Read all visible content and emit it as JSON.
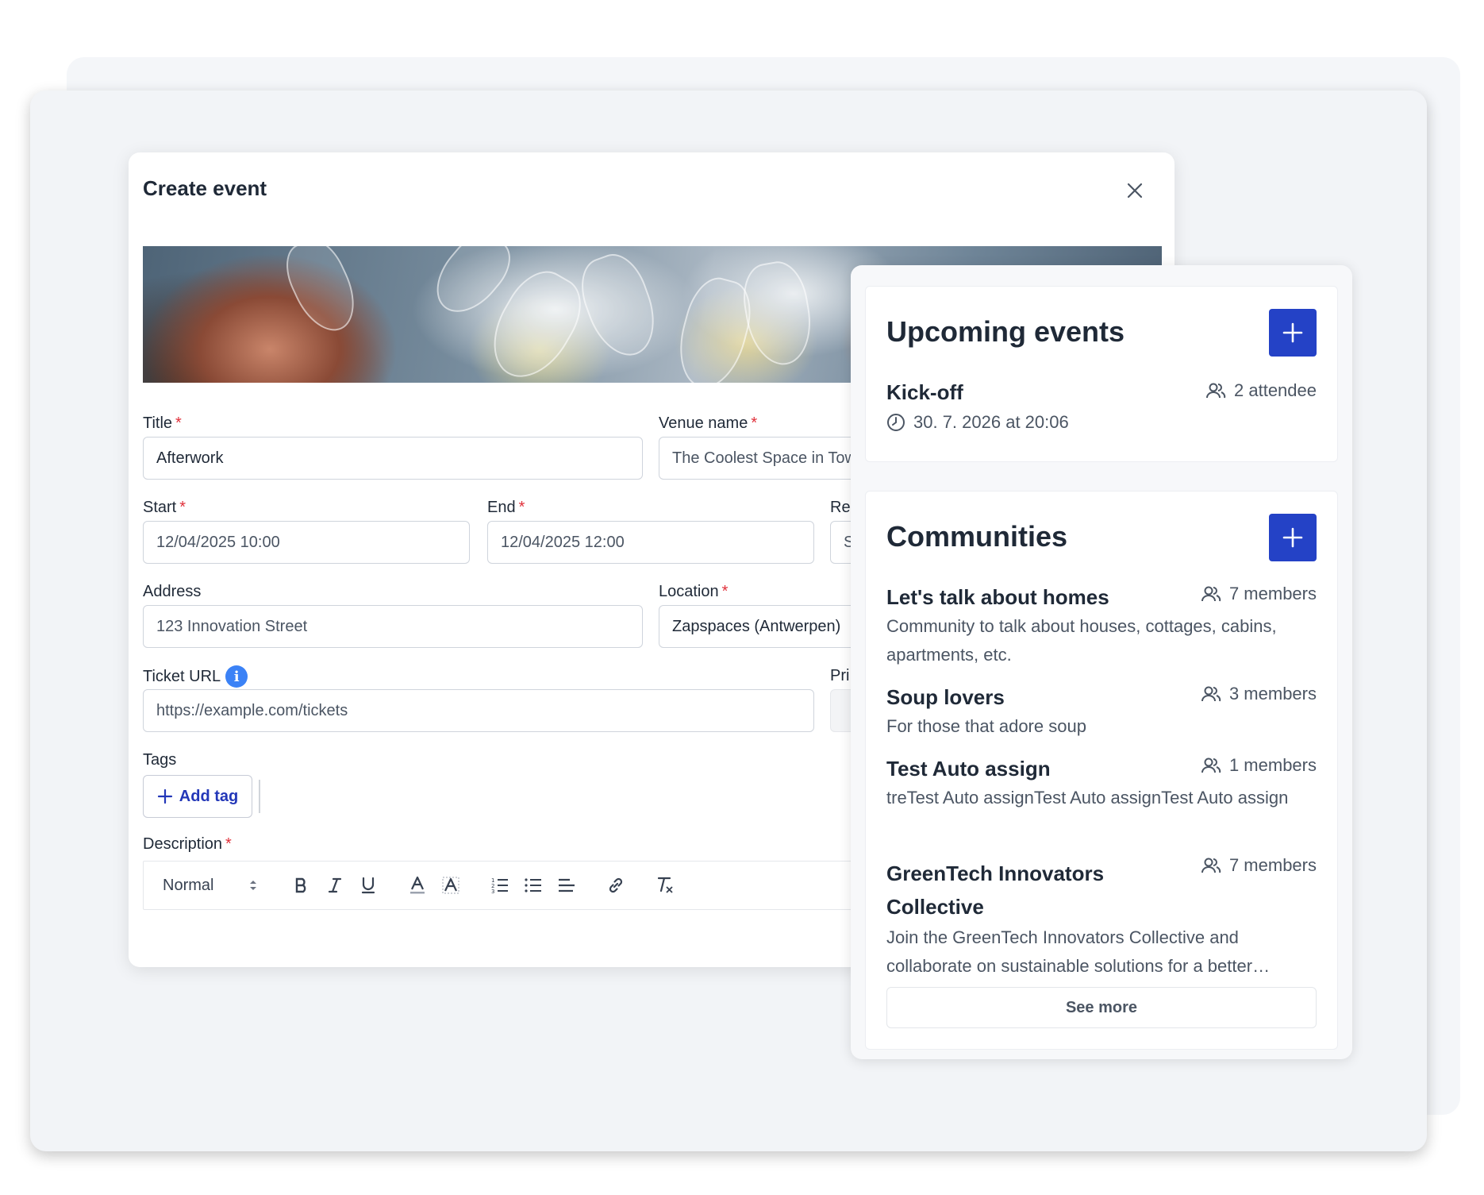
{
  "modal": {
    "title": "Create event",
    "fields": {
      "title": {
        "label": "Title",
        "value": "Afterwork"
      },
      "venue": {
        "label": "Venue name",
        "value": "The Coolest Space in Town"
      },
      "start": {
        "label": "Start",
        "value": "12/04/2025 10:00"
      },
      "end": {
        "label": "End",
        "value": "12/04/2025 12:00"
      },
      "recurrence": {
        "label": "Re",
        "value": "S"
      },
      "address": {
        "label": "Address",
        "value": "123 Innovation Street"
      },
      "location": {
        "label": "Location",
        "value": "Zapspaces (Antwerpen)"
      },
      "ticket_url": {
        "label": "Ticket URL",
        "value": "https://example.com/tickets"
      },
      "price": {
        "label": "Pri"
      },
      "tags": {
        "label": "Tags",
        "add_label": "Add tag"
      },
      "description": {
        "label": "Description"
      }
    },
    "required_mark": "*",
    "info_glyph": "i",
    "toolbar": {
      "format_value": "Normal"
    }
  },
  "upcoming": {
    "title": "Upcoming events",
    "events": [
      {
        "name": "Kick-off",
        "attendees": "2 attendee",
        "datetime": "30. 7. 2026 at 20:06"
      }
    ]
  },
  "communities": {
    "title": "Communities",
    "items": [
      {
        "name": "Let's talk about homes",
        "members": "7 members",
        "desc": "Community to talk about houses, cottages, cabins, apartments, etc."
      },
      {
        "name": "Soup lovers",
        "members": "3 members",
        "desc": "For those that adore soup"
      },
      {
        "name": "Test Auto assign",
        "members": "1 members",
        "desc": "treTest Auto assignTest Auto assignTest Auto assign"
      },
      {
        "name": "GreenTech Innovators Collective",
        "members": "7 members",
        "desc": "Join the GreenTech Innovators Collective and collaborate on sustainable solutions for a better…"
      }
    ],
    "see_more": "See more"
  },
  "colors": {
    "accent": "#2442c6",
    "required": "#e0303a",
    "info": "#3b82f6"
  }
}
